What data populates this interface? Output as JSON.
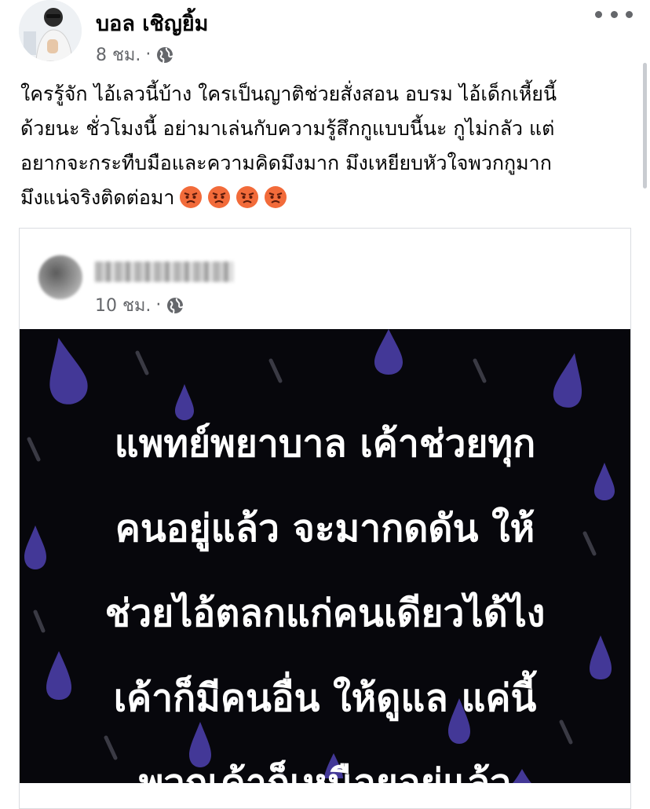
{
  "post": {
    "author": "บอล เชิญยิ้ม",
    "time": "8 ชม.",
    "separator": "·",
    "privacy_icon": "globe-icon",
    "menu_icon": "more-options-icon",
    "text_lines": [
      "ใครรู้จัก ไอ้เลวนี้บ้าง ใครเป็นญาติช่วยสั่งสอน อบรม ไอ้เด็กเหี้ยนี้",
      "ด้วยนะ ชั่วโมงนี้ อย่ามาเล่นกับความรู้สึกกูแบบนี้นะ กูไม่กลัว แต่",
      "อยากจะกระทืบมือและความคิดมึงมาก มึงเหยียบหัวใจพวกกูมาก",
      "มึงแน่จริงติดต่อมา"
    ],
    "emoji": [
      "angry-face-emoji",
      "angry-face-emoji",
      "angry-face-emoji",
      "angry-face-emoji"
    ]
  },
  "shared_post": {
    "time": "10 ชม.",
    "separator": "·",
    "privacy_icon": "globe-icon",
    "image_text_lines": [
      "แพทย์พยาบาล เค้าช่วยทุก",
      "คนอยู่แล้ว จะมากดดัน ให้",
      "ช่วยไอ้ตลกแก่คนเดียวได้ไง",
      "เค้าก็มีคนอื่น ให้ดูแล แค่นี้",
      "พวกเค้าก็เหนือยอยู่แล้ว"
    ],
    "image_colors": {
      "background": "#07070c",
      "drop": "#4b3fa8",
      "streak": "#3a3a44"
    }
  }
}
